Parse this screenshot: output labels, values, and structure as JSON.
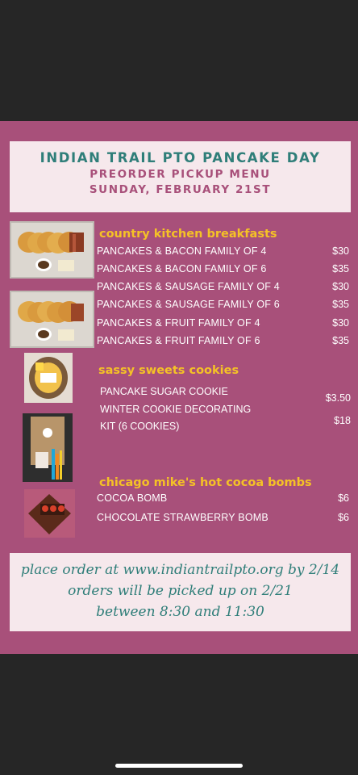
{
  "header": {
    "title": "INDIAN TRAIL PTO PANCAKE DAY",
    "subtitle1": "PREORDER PICKUP MENU",
    "subtitle2": "SUNDAY, FEBRUARY 21ST"
  },
  "sections": {
    "breakfast": {
      "title": "country kitchen breakfasts",
      "items": [
        {
          "name": "PANCAKES &  BACON FAMILY OF 4",
          "price": "$30"
        },
        {
          "name": "PANCAKES &  BACON FAMILY OF 6",
          "price": "$35"
        },
        {
          "name": "PANCAKES &  SAUSAGE FAMILY OF 4",
          "price": "$30"
        },
        {
          "name": "PANCAKES &  SAUSAGE FAMILY OF 6",
          "price": "$35"
        },
        {
          "name": "PANCAKES &  FRUIT FAMILY OF 4",
          "price": "$30"
        },
        {
          "name": "PANCAKES &  FRUIT FAMILY OF 6",
          "price": "$35"
        }
      ]
    },
    "cookies": {
      "title": "sassy sweets cookies",
      "item1_name": "PANCAKE  SUGAR COOKIE",
      "item1_price": "$3.50",
      "item2_line1": "WINTER COOKIE DECORATING",
      "item2_line2": "KIT (6 COOKIES)",
      "item2_price": "$18"
    },
    "cocoa": {
      "title": "chicago mike's hot cocoa bombs",
      "items": [
        {
          "name": "COCOA BOMB",
          "price": "$6"
        },
        {
          "name": "CHOCOLATE STRAWBERRY BOMB",
          "price": "$6"
        }
      ]
    }
  },
  "footer": {
    "line1": "place order at www.indiantrailpto.org by 2/14",
    "line2": "orders will be picked up on 2/21",
    "line3": "between 8:30 and 11:30"
  },
  "colors": {
    "poster_bg": "#a8507a",
    "title_teal": "#2f7e79",
    "section_yellow": "#f5c226",
    "panel_bg": "#f6e8ec"
  }
}
